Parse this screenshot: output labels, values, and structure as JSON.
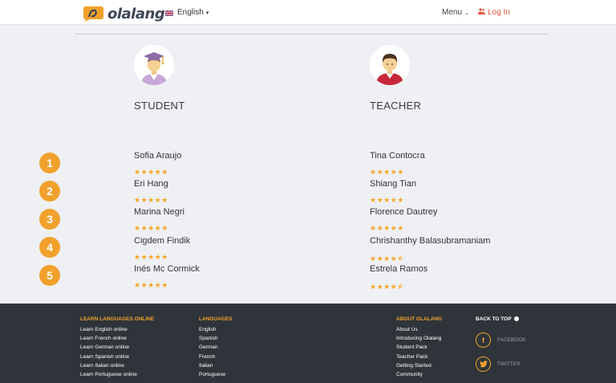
{
  "header": {
    "logo_text": "olalang",
    "language_label": "English",
    "menu_label": "Menu",
    "login_label": "Log In"
  },
  "columns": {
    "student_title": "STUDENT",
    "teacher_title": "TEACHER"
  },
  "ranks": [
    "1",
    "2",
    "3",
    "4",
    "5"
  ],
  "students": [
    {
      "name": "Sofia Araujo",
      "stars": "★★★★★"
    },
    {
      "name": "Eri Hang",
      "stars": "★★★★★"
    },
    {
      "name": "Marina Negri",
      "stars": "★★★★★"
    },
    {
      "name": "Cigdem Findik",
      "stars": "★★★★★"
    },
    {
      "name": "Inés Mc Cormick",
      "stars": "★★★★★"
    }
  ],
  "teachers": [
    {
      "name": "Tina Contocra",
      "stars": "★★★★★"
    },
    {
      "name": "Shiang Tian",
      "stars": "★★★★★"
    },
    {
      "name": "Florence Dautrey",
      "stars": "★★★★★"
    },
    {
      "name": "Chrishanthy Balasubramaniam",
      "stars": "★★★★⯪"
    },
    {
      "name": "Estrela Ramos",
      "stars": "★★★★⯪"
    }
  ],
  "footer": {
    "learn_heading": "LEARN LANGUAGES ONLINE",
    "learn_links": [
      "Learn English online",
      "Learn French online",
      "Learn German online",
      "Learn Spanish online",
      "Learn Italian online",
      "Learn Portuguese online"
    ],
    "languages_heading": "LANGUAGES",
    "languages_links": [
      "English",
      "Spanish",
      "German",
      "French",
      "Italian",
      "Portuguese"
    ],
    "about_heading": "ABOUT OLALANG",
    "about_links": [
      "About Us",
      "Introducing Olalang",
      "Student Pack",
      "Teacher Pack",
      "Getting Started",
      "Community"
    ],
    "back_to_top": "BACK TO TOP",
    "facebook_label": "FACEBOOK",
    "twitter_label": "TWITTER"
  },
  "colors": {
    "accent": "#f1a12c",
    "login": "#e8533b",
    "footer_bg": "#2f343a",
    "page_bg": "#eef0f4"
  }
}
